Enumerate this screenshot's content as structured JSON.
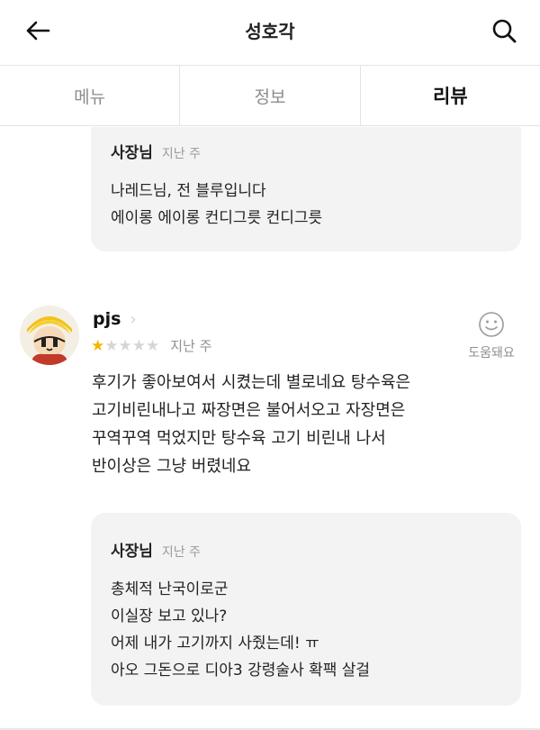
{
  "header": {
    "title": "성호각",
    "back_icon": "arrow-left-icon",
    "search_icon": "search-icon"
  },
  "tabs": [
    {
      "label": "메뉴",
      "active": false
    },
    {
      "label": "정보",
      "active": false
    },
    {
      "label": "리뷰",
      "active": true
    }
  ],
  "owner_reply_1": {
    "author": "사장님",
    "time": "지난 주",
    "lines": [
      "나레드님, 전 블루입니다",
      "에이롱 에이롱 컨디그릇 컨디그릇"
    ]
  },
  "review": {
    "username": "pjs",
    "rating": 1,
    "rating_max": 5,
    "time": "지난 주",
    "helpful_label": "도움돼요",
    "lines": [
      "후기가 좋아보여서 시켰는데 별로네요 탕수육은",
      "고기비린내나고 짜장면은 불어서오고 자장면은",
      "꾸역꾸역 먹었지만 탕수육 고기 비린내 나서",
      "반이상은 그냥 버렸네요"
    ]
  },
  "owner_reply_2": {
    "author": "사장님",
    "time": "지난 주",
    "lines": [
      "총체적 난국이로군",
      "이실장 보고 있나?",
      "어제 내가 고기까지 사줬는데! ㅠ",
      "아오 그돈으로 디아3 강령술사 확팩 살걸"
    ]
  },
  "colors": {
    "star_on": "#f5b400",
    "star_off": "#d6d6d6",
    "reply_bg": "#f3f3f3"
  }
}
